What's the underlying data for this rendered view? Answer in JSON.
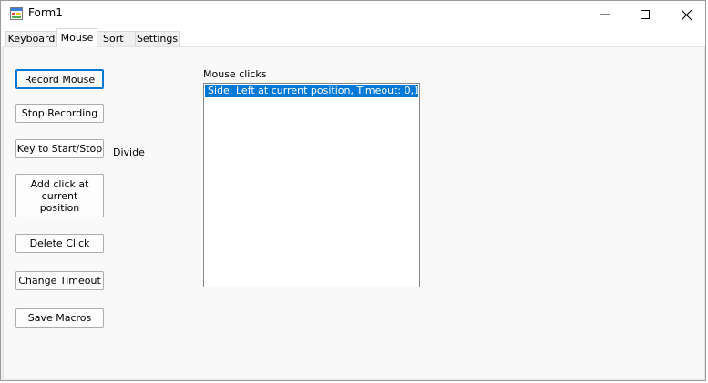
{
  "window": {
    "title": "Form1",
    "controls": {
      "minimize_icon": "minimize-icon",
      "maximize_icon": "maximize-icon",
      "close_icon": "close-icon"
    }
  },
  "tabs": [
    {
      "label": "Keyboard",
      "active": false
    },
    {
      "label": "Mouse",
      "active": true
    },
    {
      "label": "Sort",
      "active": false
    },
    {
      "label": "Settings",
      "active": false
    }
  ],
  "mouse_page": {
    "buttons": {
      "record": "Record Mouse",
      "stop": "Stop Recording",
      "key": "Key to Start/Stop",
      "add_click": "Add click at current position",
      "delete": "Delete Click",
      "timeout": "Change Timeout",
      "save": "Save Macros"
    },
    "key_value": "Divide",
    "list_label": "Mouse clicks",
    "list_items": [
      {
        "text": "Side: Left at current position, Timeout: 0,1",
        "selected": true
      }
    ]
  },
  "colors": {
    "selection": "#0078d7",
    "focus_border": "#0078d4",
    "window_background": "#f0f0f0"
  }
}
